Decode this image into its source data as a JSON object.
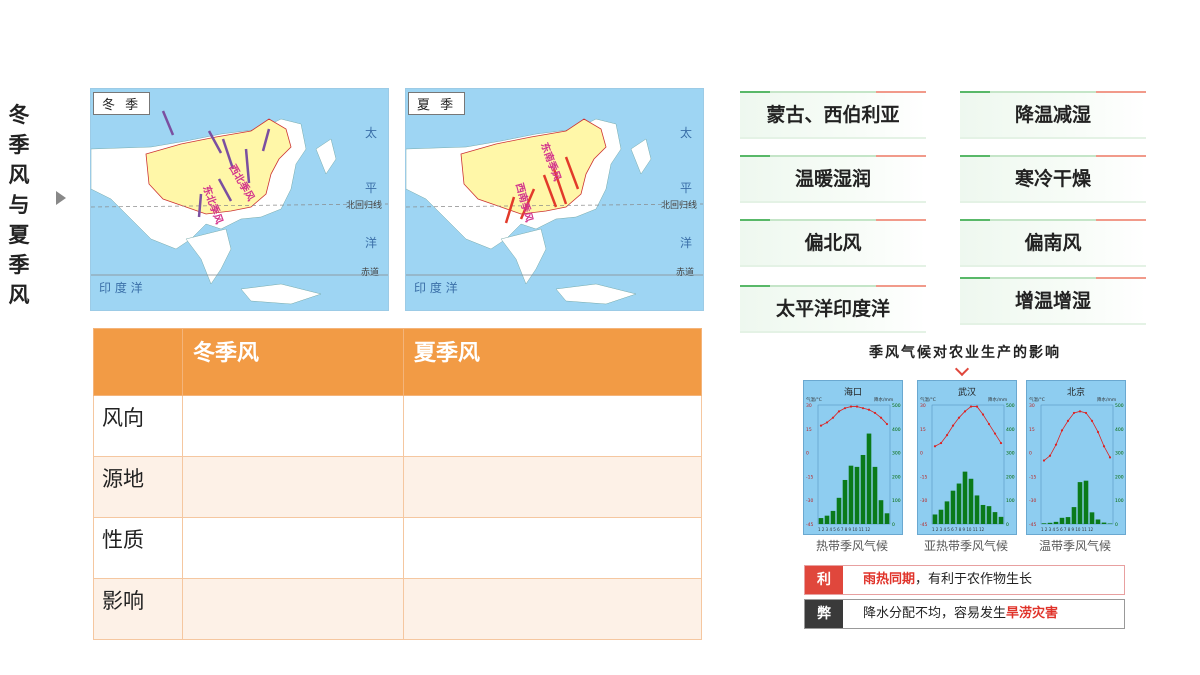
{
  "title": "冬季风与夏季风",
  "maps": [
    {
      "label": "冬 季",
      "pacific": [
        "太",
        "平",
        "洋"
      ],
      "indian": "印 度 洋",
      "tropic": "北回归线",
      "equator": "赤道",
      "wind1": "西北季风",
      "wind2": "东北季风"
    },
    {
      "label": "夏 季",
      "pacific": [
        "太",
        "平",
        "洋"
      ],
      "indian": "印 度 洋",
      "tropic": "北回归线",
      "equator": "赤道",
      "wind1": "东南季风",
      "wind2": "西南季风"
    }
  ],
  "table": {
    "headers": [
      "",
      "冬季风",
      "夏季风"
    ],
    "rows": [
      "风向",
      "源地",
      "性质",
      "影响"
    ]
  },
  "cards": [
    "蒙古、西伯利亚",
    "降温减湿",
    "温暖湿润",
    "寒冷干燥",
    "偏北风",
    "偏南风",
    "太平洋印度洋",
    "增温增湿"
  ],
  "climate": {
    "subtitle": "季风气候对农业生产的影响",
    "charts": [
      {
        "city": "海口",
        "caption": "热带季风气候",
        "temp": [
          17,
          19,
          22,
          26,
          28,
          29,
          29,
          28,
          27,
          25,
          22,
          18
        ],
        "precip": [
          25,
          35,
          55,
          110,
          185,
          245,
          240,
          290,
          380,
          240,
          100,
          45
        ]
      },
      {
        "city": "武汉",
        "caption": "亚热带季风气候",
        "temp": [
          4,
          6,
          11,
          17,
          22,
          26,
          29,
          29,
          24,
          18,
          12,
          6
        ],
        "precip": [
          40,
          60,
          95,
          140,
          170,
          220,
          190,
          120,
          80,
          75,
          50,
          30
        ]
      },
      {
        "city": "北京",
        "caption": "温带季风气候",
        "temp": [
          -5,
          -2,
          5,
          14,
          20,
          25,
          26,
          25,
          20,
          13,
          4,
          -3
        ],
        "precip": [
          3,
          5,
          9,
          26,
          29,
          71,
          176,
          182,
          49,
          19,
          6,
          2
        ]
      }
    ],
    "axis": {
      "t_label": "气温/°C",
      "p_label": "降水/mm",
      "t_ticks": [
        "30",
        "15",
        "0",
        "-15",
        "-30",
        "-45"
      ],
      "p_ticks": [
        "500",
        "400",
        "300",
        "200",
        "100",
        "0"
      ],
      "months": "1 2 3 4 5 6 7 8 9 10 11 12"
    }
  },
  "pros": {
    "tag": "利",
    "hl": "雨热同期",
    "rest": "，有利于农作物生长"
  },
  "cons": {
    "tag": "弊",
    "pre": "降水分配不均，容易发生",
    "hl": "旱涝灾害"
  },
  "colors": {
    "header": "#f29b45",
    "tag_pro": "#e0473c",
    "tag_con": "#3a3a3a",
    "land": "#fff7a8"
  }
}
